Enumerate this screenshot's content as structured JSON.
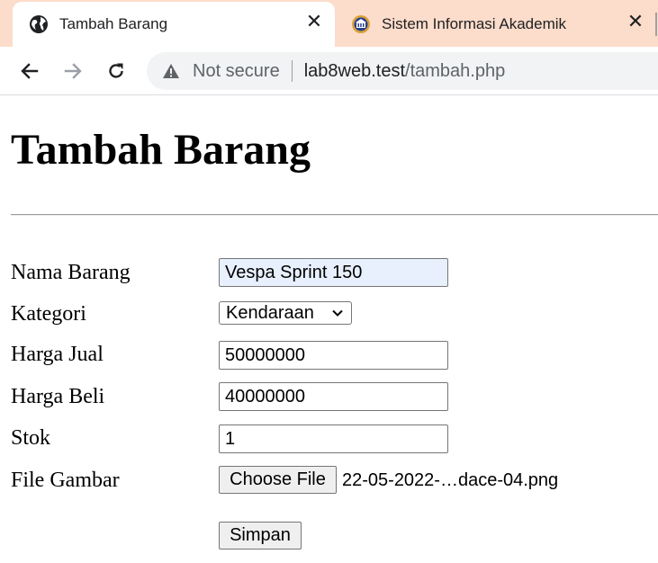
{
  "browser": {
    "tabs": [
      {
        "title": "Tambah Barang",
        "active": true,
        "icon": "globe-icon"
      },
      {
        "title": "Sistem Informasi Akademik",
        "active": false,
        "icon": "university-logo-icon"
      }
    ],
    "address": {
      "security_label": "Not secure",
      "host": "lab8web.test",
      "path": "/tambah.php"
    },
    "colors": {
      "tabbar": "#fcdcca",
      "omnibox": "#f1f3f4"
    }
  },
  "page": {
    "title": "Tambah Barang",
    "form": {
      "nama_barang": {
        "label": "Nama Barang",
        "value": "Vespa Sprint 150"
      },
      "kategori": {
        "label": "Kategori",
        "selected": "Kendaraan"
      },
      "harga_jual": {
        "label": "Harga Jual",
        "value": "50000000"
      },
      "harga_beli": {
        "label": "Harga Beli",
        "value": "40000000"
      },
      "stok": {
        "label": "Stok",
        "value": "1"
      },
      "file_gambar": {
        "label": "File Gambar",
        "button_label": "Choose File",
        "file_name": "22-05-2022-…dace-04.png"
      },
      "submit_label": "Simpan"
    }
  }
}
